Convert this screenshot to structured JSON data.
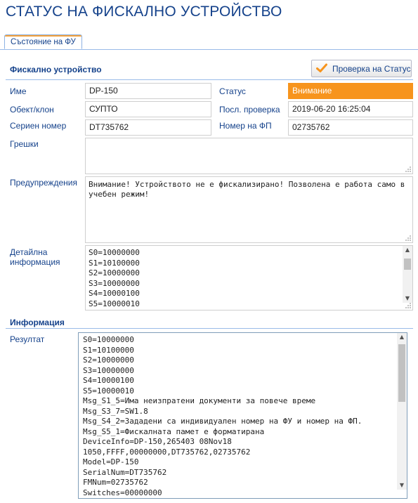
{
  "page": {
    "title": "СТАТУС НА ФИСКАЛНО УСТРОЙСТВО"
  },
  "tabs": [
    {
      "label": "Състояние на ФУ",
      "active": true
    }
  ],
  "device_section": {
    "title": "Фискално устройство",
    "check_button": {
      "label": "Проверка на Статус",
      "icon": "checkmark-icon"
    },
    "name": {
      "label": "Име",
      "value": "DP-150"
    },
    "status": {
      "label": "Статус",
      "value": "Внимание",
      "color": "#f7941d"
    },
    "site": {
      "label": "Обект/клон",
      "value": "СУПТО"
    },
    "last_check": {
      "label": "Посл. проверка",
      "value": "2019-06-20 16:25:04"
    },
    "serial": {
      "label": "Сериен номер",
      "value": "DT735762"
    },
    "fp_number": {
      "label": "Номер на ФП",
      "value": "02735762"
    },
    "errors": {
      "label": "Грешки",
      "value": ""
    },
    "warnings": {
      "label": "Предупреждения",
      "value": "Внимание! Устройството не е фискализирано! Позволена е работа само в учебен режим!"
    },
    "details": {
      "label_line1": "Детайлна",
      "label_line2": "информация",
      "lines": [
        "S0=10000000",
        "S1=10100000",
        "S2=10000000",
        "S3=10000000",
        "S4=10000100",
        "S5=10000010"
      ]
    }
  },
  "info_section": {
    "title": "Информация",
    "result": {
      "label": "Резултат",
      "lines": [
        "S0=10000000",
        "S1=10100000",
        "S2=10000000",
        "S3=10000000",
        "S4=10000100",
        "S5=10000010",
        "Msg_S1_5=Има неизпратени документи за повече време",
        "Msg_S3_7=SW1.8",
        "Msg_S4_2=Зададени са индивидуален номер на ФУ и номер на ФП.",
        "Msg_S5_1=Фискалната памет е форматирана",
        "DeviceInfo=DP-150,265403 08Nov18",
        "1050,FFFF,00000000,DT735762,02735762",
        "Model=DP-150",
        "SerialNum=DT735762",
        "FMNum=02735762",
        "Switches=00000000"
      ]
    }
  },
  "colors": {
    "accent": "#15428b",
    "tab_border": "#99bbe8",
    "warning": "#f7941d",
    "check": "#f7941d"
  }
}
